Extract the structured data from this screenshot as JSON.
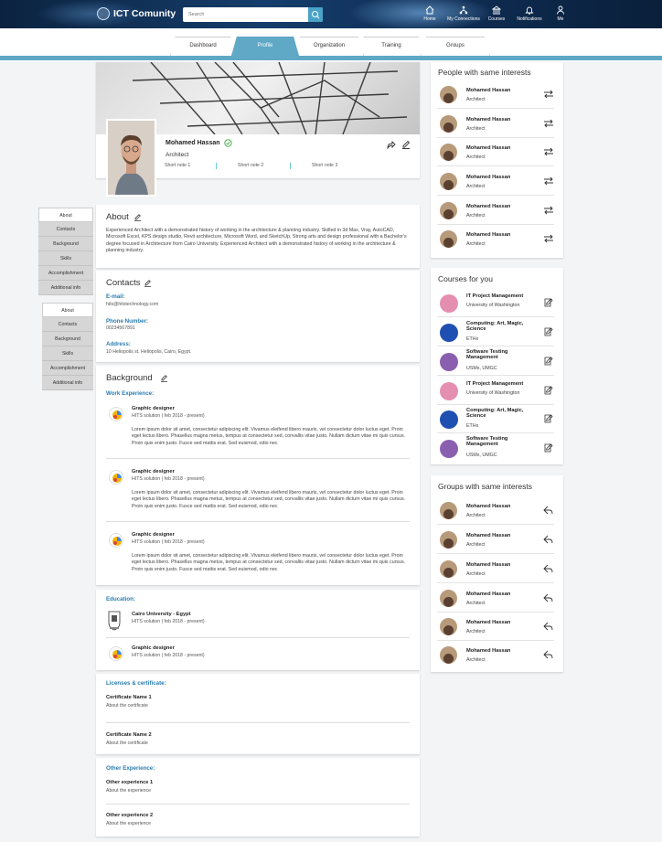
{
  "header": {
    "app_name": "ICT Comunity",
    "search_placeholder": "Search",
    "nav": [
      {
        "label": "Home",
        "icon": "home-icon"
      },
      {
        "label": "My Connections",
        "icon": "connections-icon"
      },
      {
        "label": "Courses",
        "icon": "courses-icon"
      },
      {
        "label": "Notifications",
        "icon": "bell-icon"
      },
      {
        "label": "Me",
        "icon": "user-icon"
      }
    ]
  },
  "tabs": [
    "Dashboard",
    "Profile",
    "Organization",
    "Training",
    "Groups"
  ],
  "active_tab": "Profile",
  "profile": {
    "name": "Mohamed Hassan",
    "role": "Architect",
    "notes": [
      "Short note 1",
      "Short note 2",
      "Short note 3"
    ]
  },
  "sidenav_top": [
    "About",
    "Contacts",
    "Background",
    "Skills",
    "Accomplishment",
    "Additional info"
  ],
  "sidenav_bottom": [
    "About",
    "Contacts",
    "Background",
    "Skills",
    "Accomplishment",
    "Additional info"
  ],
  "about": {
    "title": "About",
    "text": "Experienced Architect with a demonstrated history of working in the architecture & planning industry. Skilled in 3d Max, Vray, AutoCAD, Microsoft Excel, KPS design studio, Revit architecture, Microsoft Word, and SketchUp. Strong arts and design professional with a Bachelor's degree focused in Architecture from Cairo University.  Experienced Architect with a demonstrated history of working in the architecture & planning industry."
  },
  "contacts": {
    "title": "Contacts",
    "email_label": "E-mail:",
    "email": "hits@hitstechnology.com",
    "phone_label": "Phone Number:",
    "phone": "00234567891",
    "address_label": "Address:",
    "address": "10 Heliopolis st. Heliopolis, Cairo, Egypt."
  },
  "background": {
    "title": "Background",
    "work_label": "Work Experience:",
    "jobs": [
      {
        "title": "Graphic designer",
        "company": "HITS solution ( feb 2018 - present)",
        "desc": "Lorem ipsum dolor sit amet, consectetur adipiscing elit. Vivamus eleifend libero mauris, vel consectetur dolor luctus eget. Proin eget lectus libero. Phasellus magna metus, tempus at consectetur sed, convallis vitae justo. Nullam dictum vitae mi quis cursus. Proin quis enim justo. Fusce sed mattis erat. Sed euismod, odio nec"
      },
      {
        "title": "Graphic designer",
        "company": "HITS solution ( feb 2018 - present)",
        "desc": "Lorem ipsum dolor sit amet, consectetur adipiscing elit. Vivamus eleifend libero mauris, vel consectetur dolor luctus eget. Proin eget lectus libero. Phasellus magna metus, tempus at consectetur sed, convallis vitae justo. Nullam dictum vitae mi quis cursus. Proin quis enim justo. Fusce sed mattis erat. Sed euismod, odio nec"
      },
      {
        "title": "Graphic designer",
        "company": "HITS solution ( feb 2018 - present)",
        "desc": "Lorem ipsum dolor sit amet, consectetur adipiscing elit. Vivamus eleifend libero mauris, vel consectetur dolor luctus eget. Proin eget lectus libero. Phasellus magna metus, tempus at consectetur sed, convallis vitae justo. Nullam dictum vitae mi quis cursus. Proin quis enim justo. Fusce sed mattis erat. Sed euismod, odio nec"
      }
    ],
    "education_label": "Education:",
    "education": [
      {
        "title": "Cairo University - Egypt",
        "sub": "HITS solution ( feb 2018 - present)"
      },
      {
        "title": "Graphic designer",
        "sub": "HITS solution ( feb 2018 - present)"
      }
    ]
  },
  "licenses": {
    "label": "Licenses & certificate:",
    "items": [
      {
        "name": "Certificate Name 1",
        "sub": "About the certificate"
      },
      {
        "name": "Certificate Name 2",
        "sub": "About the certificate"
      }
    ]
  },
  "other": {
    "label": "Other Experience:",
    "items": [
      {
        "name": "Other experience 1",
        "sub": "About the experience"
      },
      {
        "name": "Other experience 2",
        "sub": "About the experience"
      }
    ]
  },
  "people": {
    "title": "People with same interests",
    "items": [
      {
        "name": "Mohamed Hassan",
        "role": "Architect"
      },
      {
        "name": "Mohamed Hassan",
        "role": "Architect"
      },
      {
        "name": "Mohamed Hassan",
        "role": "Architect"
      },
      {
        "name": "Mohamed Hassan",
        "role": "Architect"
      },
      {
        "name": "Mohamed Hassan",
        "role": "Architect"
      },
      {
        "name": "Mohamed Hassan",
        "role": "Architect"
      }
    ]
  },
  "courses": {
    "title": "Courses for you",
    "items": [
      {
        "name": "IT Project Management",
        "provider": "University of Washington",
        "color": "#e58fb0"
      },
      {
        "name": "Computing: Art, Magic, Science",
        "provider": "ETHx",
        "color": "#1f4fb0"
      },
      {
        "name": "Software Testing Management",
        "provider": "USMx, UMGC",
        "color": "#8a5fb0"
      },
      {
        "name": "IT Project Management",
        "provider": "University of Washington",
        "color": "#e58fb0"
      },
      {
        "name": "Computing: Art, Magic, Science",
        "provider": "ETHx",
        "color": "#1f4fb0"
      },
      {
        "name": "Software Testing Management",
        "provider": "USMx, UMGC",
        "color": "#8a5fb0"
      }
    ]
  },
  "groups": {
    "title": "Groups with same interests",
    "items": [
      {
        "name": "Mohamed Hassan",
        "role": "Architect"
      },
      {
        "name": "Mohamed Hassan",
        "role": "Architect"
      },
      {
        "name": "Mohamed Hassan",
        "role": "Architect"
      },
      {
        "name": "Mohamed Hassan",
        "role": "Architect"
      },
      {
        "name": "Mohamed Hassan",
        "role": "Architect"
      },
      {
        "name": "Mohamed Hassan",
        "role": "Architect"
      }
    ]
  }
}
